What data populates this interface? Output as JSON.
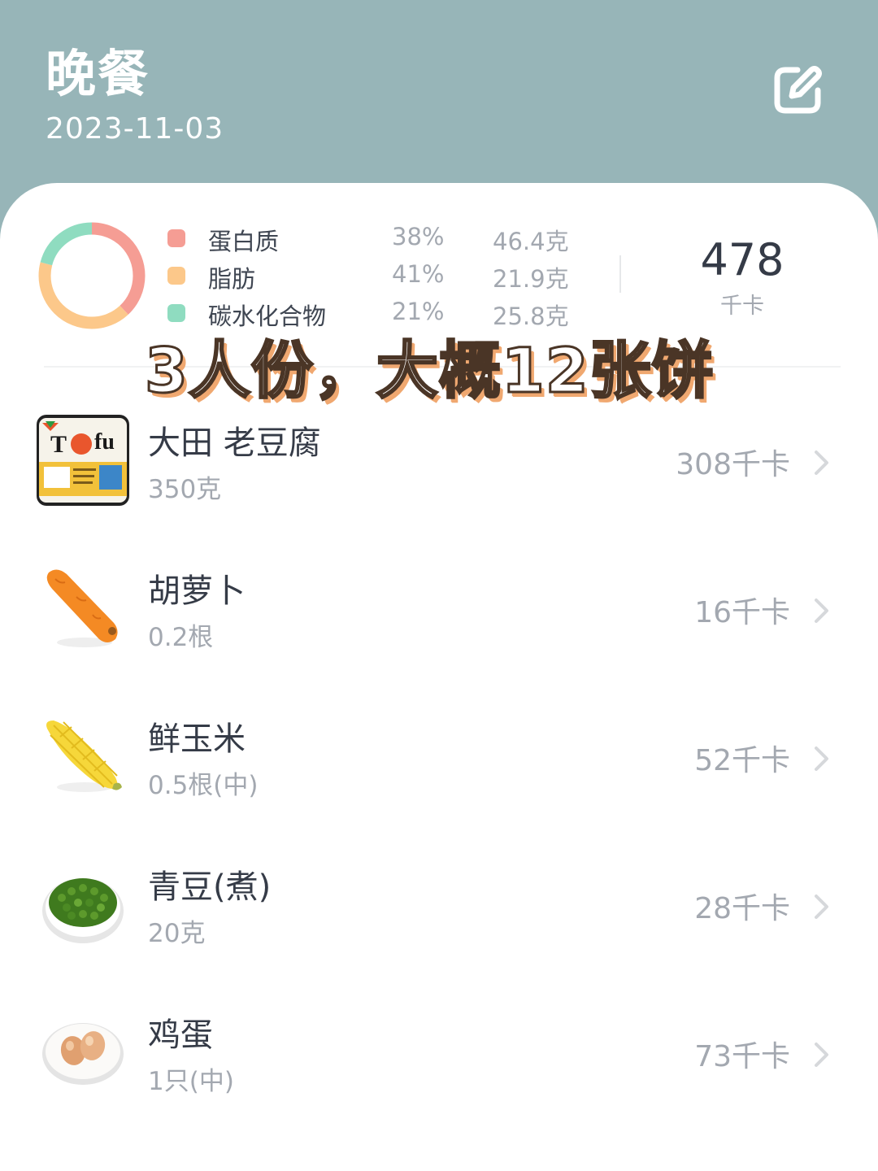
{
  "header": {
    "title": "晚餐",
    "date": "2023-11-03",
    "edit_icon": "edit-icon"
  },
  "summary": {
    "total_kcal": "478",
    "total_unit": "千卡",
    "macros": [
      {
        "name": "蛋白质",
        "percent": "38%",
        "amount": "46.4克",
        "color": "#f59d94"
      },
      {
        "name": "脂肪",
        "percent": "41%",
        "amount": "21.9克",
        "color": "#fcc88a"
      },
      {
        "name": "碳水化合物",
        "percent": "21%",
        "amount": "25.8克",
        "color": "#8fdcc0"
      }
    ]
  },
  "overlay_caption": "3人份，大概12张饼",
  "foods": [
    {
      "name": "大田 老豆腐",
      "amount": "350克",
      "kcal": "308千卡",
      "icon": "tofu-package-icon"
    },
    {
      "name": "胡萝卜",
      "amount": "0.2根",
      "kcal": "16千卡",
      "icon": "carrot-icon"
    },
    {
      "name": "鲜玉米",
      "amount": "0.5根(中)",
      "kcal": "52千卡",
      "icon": "corn-icon"
    },
    {
      "name": "青豆(煮)",
      "amount": "20克",
      "kcal": "28千卡",
      "icon": "green-peas-icon"
    },
    {
      "name": "鸡蛋",
      "amount": "1只(中)",
      "kcal": "73千卡",
      "icon": "eggs-icon"
    }
  ]
}
